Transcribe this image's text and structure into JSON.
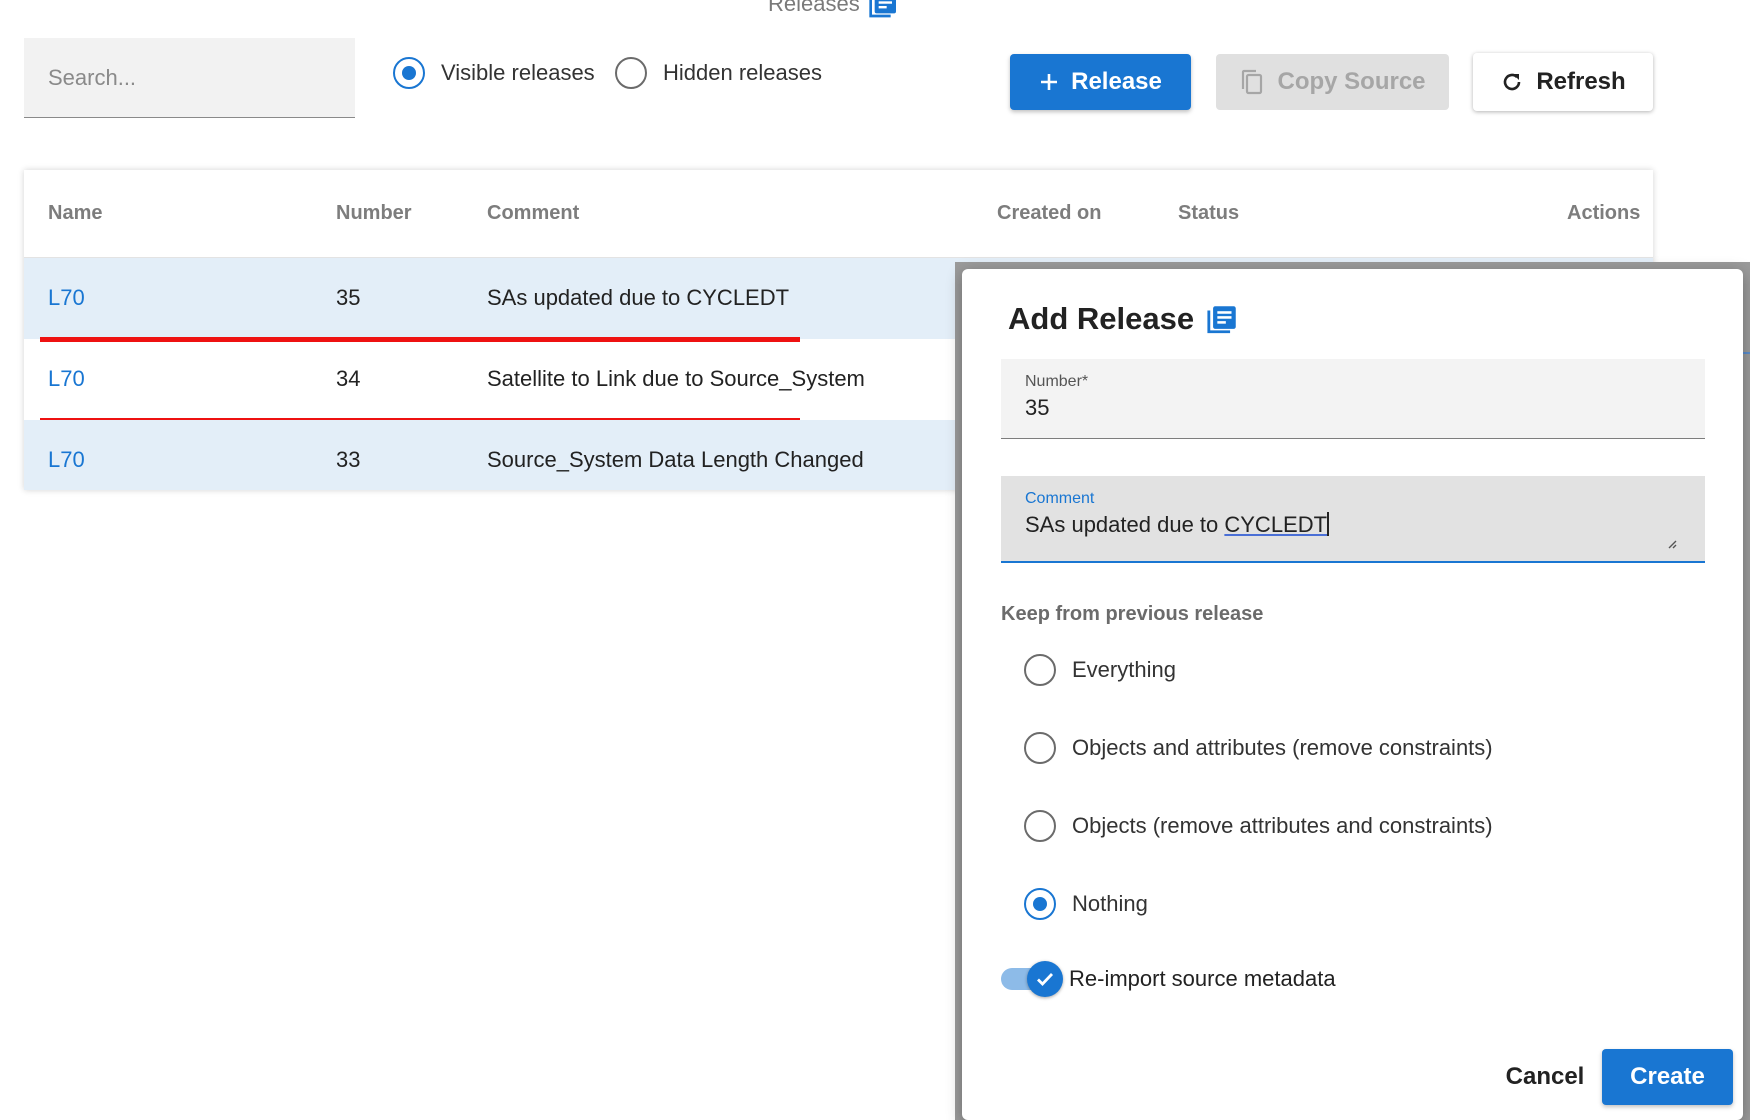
{
  "page": {
    "title": "Releases"
  },
  "search": {
    "placeholder": "Search..."
  },
  "filter": {
    "options": [
      {
        "label": "Visible releases",
        "selected": true
      },
      {
        "label": "Hidden releases",
        "selected": false
      }
    ]
  },
  "toolbar": {
    "add_label": "Release",
    "copy_label": "Copy Source",
    "refresh_label": "Refresh"
  },
  "table": {
    "headers": [
      "Name",
      "Number",
      "Comment",
      "Created on",
      "Status",
      "Actions"
    ],
    "rows": [
      {
        "name": "L70",
        "number": "35",
        "comment": "SAs updated due to CYCLEDT"
      },
      {
        "name": "L70",
        "number": "34",
        "comment": "Satellite to Link due to Source_System"
      },
      {
        "name": "L70",
        "number": "33",
        "comment": "Source_System Data Length Changed"
      }
    ]
  },
  "dialog": {
    "title": "Add Release",
    "number_label": "Number*",
    "number_value": "35",
    "comment_label": "Comment",
    "comment_prefix": "SAs updated due to ",
    "comment_highlight": "CYCLEDT",
    "keep_label": "Keep from previous release",
    "keep_options": [
      {
        "label": "Everything",
        "selected": false
      },
      {
        "label": "Objects and attributes (remove constraints)",
        "selected": false
      },
      {
        "label": "Objects (remove attributes and constraints)",
        "selected": false
      },
      {
        "label": "Nothing",
        "selected": true
      }
    ],
    "reimport_label": "Re-import source metadata",
    "reimport_checked": true,
    "cancel_label": "Cancel",
    "create_label": "Create"
  },
  "colors": {
    "primary": "#1976d2",
    "row_shade": "#e3eef8",
    "highlight_underline": "#ee1111"
  }
}
